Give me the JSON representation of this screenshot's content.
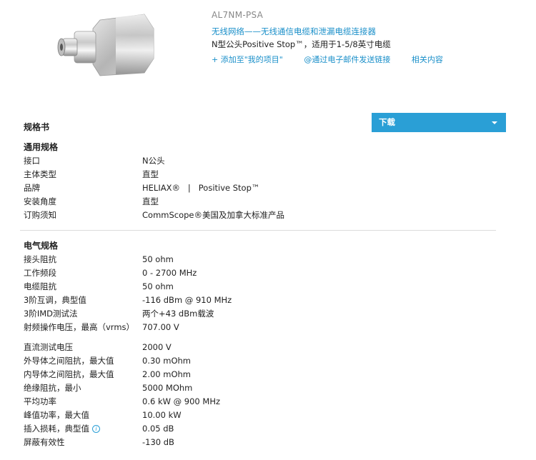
{
  "product": {
    "model": "AL7NM-PSA",
    "category": "无线网络——无线通信电缆和泄漏电缆连接器",
    "description": "N型公头Positive Stop™，适用于1-5/8英寸电缆",
    "actions": [
      "+ 添加至\"我的项目\"",
      "@通过电子邮件发送链接",
      "相关内容"
    ]
  },
  "spec": {
    "title": "规格书",
    "download_label": "下载",
    "general": {
      "heading": "通用规格",
      "rows": [
        {
          "label": "接口",
          "value": "N公头"
        },
        {
          "label": "主体类型",
          "value": "直型"
        },
        {
          "label": "品牌",
          "value": "HELIAX®   |   Positive Stop™"
        },
        {
          "label": "安装角度",
          "value": "直型"
        },
        {
          "label": "订购须知",
          "value": "CommScope®美国及加拿大标准产品"
        }
      ]
    },
    "electrical": {
      "heading": "电气规格",
      "rows": [
        {
          "label": "接头阻抗",
          "value": "50 ohm"
        },
        {
          "label": "工作频段",
          "value": "0 - 2700 MHz"
        },
        {
          "label": "电缆阻抗",
          "value": "50 ohm"
        },
        {
          "label": "3阶互调，典型值",
          "value": "-116 dBm @ 910 MHz"
        },
        {
          "label": "3阶IMD测试法",
          "value": "两个+43 dBm载波"
        },
        {
          "label": "射频操作电压，最高（vrms）",
          "value": "707.00 V"
        }
      ],
      "rows2": [
        {
          "label": "直流测试电压",
          "value": "2000 V"
        },
        {
          "label": "外导体之间阻抗，最大值",
          "value": "0.30 mOhm"
        },
        {
          "label": "内导体之间阻抗，最大值",
          "value": "2.00 mOhm"
        },
        {
          "label": "绝缘阻抗，最小",
          "value": "5000 MOhm"
        },
        {
          "label": "平均功率",
          "value": "0.6 kW @ 900 MHz"
        },
        {
          "label": "峰值功率，最大值",
          "value": "10.00 kW"
        },
        {
          "label": "插入损耗，典型值",
          "value": "0.05 dB"
        },
        {
          "label": "屏蔽有效性",
          "value": "-130 dB"
        }
      ]
    }
  },
  "colors": {
    "accent": "#2a9fd6",
    "link": "#1a8fc9"
  }
}
